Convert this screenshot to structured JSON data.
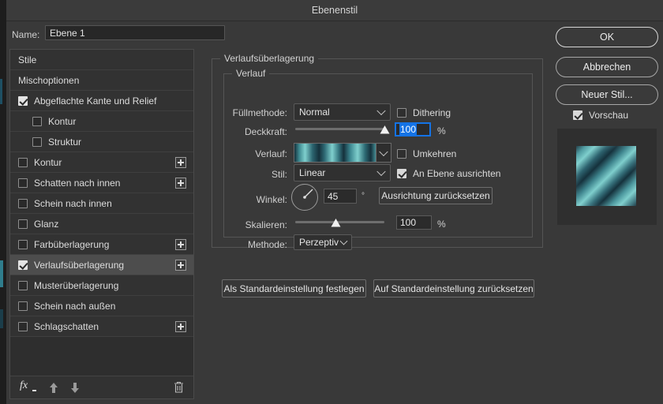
{
  "window": {
    "title": "Ebenenstil"
  },
  "name_field": {
    "label": "Name:",
    "value": "Ebene 1"
  },
  "sidebar": {
    "items": [
      {
        "label": "Stile",
        "type": "header",
        "checkbox": null,
        "plus": false,
        "selected": false
      },
      {
        "label": "Mischoptionen",
        "type": "header",
        "checkbox": null,
        "plus": false,
        "selected": false
      },
      {
        "label": "Abgeflachte Kante und Relief",
        "type": "effect",
        "checkbox": true,
        "plus": false,
        "selected": false
      },
      {
        "label": "Kontur",
        "type": "sub",
        "checkbox": false,
        "plus": false,
        "selected": false
      },
      {
        "label": "Struktur",
        "type": "sub",
        "checkbox": false,
        "plus": false,
        "selected": false
      },
      {
        "label": "Kontur",
        "type": "effect",
        "checkbox": false,
        "plus": true,
        "selected": false
      },
      {
        "label": "Schatten nach innen",
        "type": "effect",
        "checkbox": false,
        "plus": true,
        "selected": false
      },
      {
        "label": "Schein nach innen",
        "type": "effect",
        "checkbox": false,
        "plus": false,
        "selected": false
      },
      {
        "label": "Glanz",
        "type": "effect",
        "checkbox": false,
        "plus": false,
        "selected": false
      },
      {
        "label": "Farbüberlagerung",
        "type": "effect",
        "checkbox": false,
        "plus": true,
        "selected": false
      },
      {
        "label": "Verlaufsüberlagerung",
        "type": "effect",
        "checkbox": true,
        "plus": true,
        "selected": true
      },
      {
        "label": "Musterüberlagerung",
        "type": "effect",
        "checkbox": false,
        "plus": false,
        "selected": false
      },
      {
        "label": "Schein nach außen",
        "type": "effect",
        "checkbox": false,
        "plus": false,
        "selected": false
      },
      {
        "label": "Schlagschatten",
        "type": "effect",
        "checkbox": false,
        "plus": true,
        "selected": false
      }
    ],
    "footer": {
      "fx": "fx-icon",
      "up": "arrow-up-icon",
      "down": "arrow-down-icon",
      "delete": "trash-icon"
    }
  },
  "main": {
    "section_title": "Verlaufsüberlagerung",
    "group_title": "Verlauf",
    "blend_mode": {
      "label": "Füllmethode:",
      "value": "Normal"
    },
    "dithering": {
      "label": "Dithering",
      "checked": false
    },
    "opacity": {
      "label": "Deckkraft:",
      "value": "100",
      "unit": "%",
      "slider_percent": 100,
      "focused": true
    },
    "gradient": {
      "label": "Verlauf:"
    },
    "reverse": {
      "label": "Umkehren",
      "checked": false
    },
    "style": {
      "label": "Stil:",
      "value": "Linear"
    },
    "align_layer": {
      "label": "An Ebene ausrichten",
      "checked": true
    },
    "angle": {
      "label": "Winkel:",
      "value": "45",
      "unit": "°"
    },
    "reset_align_button": "Ausrichtung zurücksetzen",
    "scale": {
      "label": "Skalieren:",
      "value": "100",
      "unit": "%",
      "slider_percent": 45
    },
    "method": {
      "label": "Methode:",
      "value": "Perzeptiv"
    },
    "set_default_button": "Als Standardeinstellung festlegen",
    "reset_default_button": "Auf Standardeinstellung zurücksetzen"
  },
  "right": {
    "ok": "OK",
    "cancel": "Abbrechen",
    "new_style": "Neuer Stil...",
    "preview": {
      "label": "Vorschau",
      "checked": true
    }
  },
  "colors": {
    "dialog_bg": "#393939",
    "list_bg": "#323232",
    "selected_row": "#4d4d4d",
    "accent_blue": "#1473e6",
    "gradient_light": "#7fcfcd",
    "gradient_dark": "#15313c"
  }
}
